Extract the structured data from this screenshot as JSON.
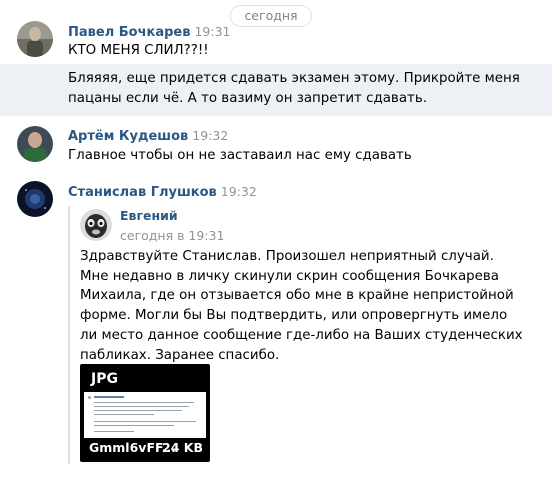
{
  "date_divider": "сегодня",
  "messages": [
    {
      "author": "Павел Бочкарев",
      "time": "19:31",
      "lines": [
        "КТО МЕНЯ СЛИЛ??!!"
      ]
    },
    {
      "lines": [
        "Бляяяя, еще придется сдавать экзамен этому. Прикройте меня",
        "пацаны если чё. А то вазиму он запретит сдавать."
      ]
    },
    {
      "author": "Артём Кудешов",
      "time": "19:32",
      "lines": [
        "Главное чтобы он не заставаил нас ему сдавать"
      ]
    },
    {
      "author": "Станислав Глушков",
      "time": "19:32"
    }
  ],
  "forwarded": {
    "author": "Евгений",
    "date": "сегодня в 19:31",
    "lines": [
      "Здравствуйте Станислав. Произошел неприятный случай.",
      "Мне недавно в личку скинули скрин сообщения Бочкарева",
      "Михаила, где он отзывается обо мне в крайне непристойной",
      "форме. Могли бы Вы подтвердить, или опровергнуть имело",
      "ли место данное сообщение где-либо на Ваших студенческих",
      "пабликах. Заранее спасибо."
    ],
    "attachment": {
      "type": "JPG",
      "name": "Gmml6vFF...",
      "size": "24 KB"
    }
  },
  "colors": {
    "link": "#2a5885",
    "time": "#939393",
    "highlight_bg": "#edf0f5"
  }
}
